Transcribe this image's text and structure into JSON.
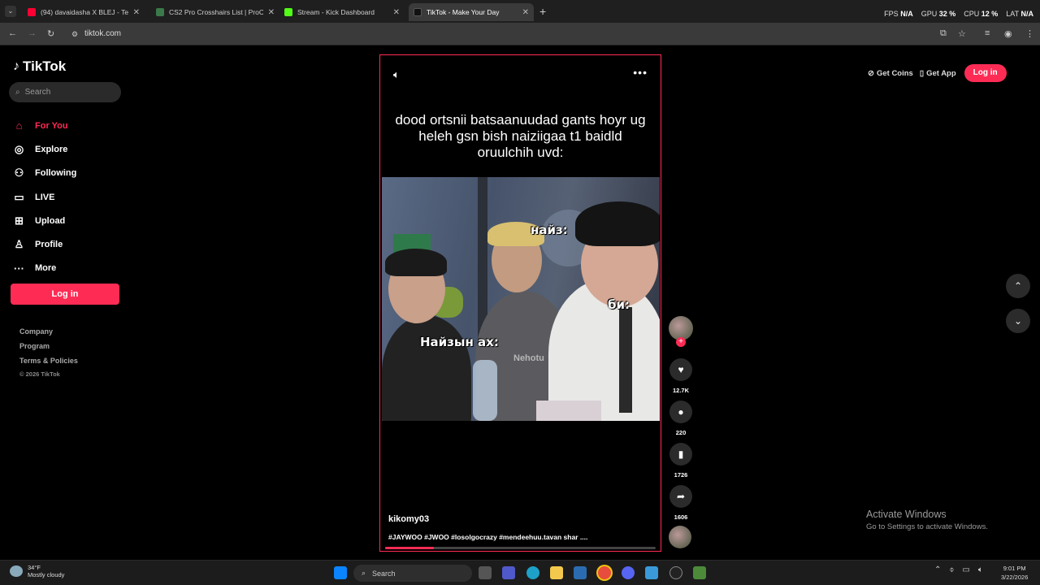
{
  "browser": {
    "tabs": [
      {
        "title": "(94) davaidasha X BLEJ - Temtm",
        "favicon_color": "#ff0033",
        "active": false
      },
      {
        "title": "CS2 Pro Crosshairs List | ProCro",
        "favicon_color": "#3a7a4a",
        "active": false
      },
      {
        "title": "Stream - Kick Dashboard",
        "favicon_color": "#53fc18",
        "active": false
      },
      {
        "title": "TikTok - Make Your Day",
        "favicon_color": "#111111",
        "active": true
      }
    ],
    "url": "tiktok.com",
    "perf": {
      "fps_label": "FPS",
      "fps": "N/A",
      "gpu_label": "GPU",
      "gpu": "32 %",
      "cpu_label": "CPU",
      "cpu": "12 %",
      "lat_label": "LAT",
      "lat": "N/A"
    }
  },
  "sidebar": {
    "logo": "TikTok",
    "search_placeholder": "Search",
    "items": [
      {
        "label": "For You",
        "icon": "home-icon",
        "active": true
      },
      {
        "label": "Explore",
        "icon": "compass-icon",
        "active": false
      },
      {
        "label": "Following",
        "icon": "following-icon",
        "active": false
      },
      {
        "label": "LIVE",
        "icon": "live-icon",
        "active": false
      },
      {
        "label": "Upload",
        "icon": "upload-icon",
        "active": false
      },
      {
        "label": "Profile",
        "icon": "profile-icon",
        "active": false
      },
      {
        "label": "More",
        "icon": "more-icon",
        "active": false
      }
    ],
    "login_label": "Log in",
    "footer_links": [
      "Company",
      "Program",
      "Terms & Policies"
    ],
    "copyright": "© 2026 TikTok"
  },
  "video": {
    "caption": "dood ortsnii batsaanuudad gants hoyr ug heleh gsn bish naiziigaa t1 baidld oruulchih uvd:",
    "overlay_labels": [
      "найз:",
      "би:",
      "Найзын ах:"
    ],
    "watermark": "Nehotu",
    "username": "kikomy03",
    "description": "#JAYWOO #JWOO #losolgocrazy #mendeehuu.tavan shar ....",
    "progress": 0.18
  },
  "actions": {
    "likes": "12.7K",
    "comments": "220",
    "saves": "1726",
    "shares": "1606"
  },
  "topbar": {
    "get_coins": "Get Coins",
    "get_app": "Get App",
    "login_label": "Log in"
  },
  "watermark_windows": {
    "line1": "Activate Windows",
    "line2": "Go to Settings to activate Windows."
  },
  "taskbar": {
    "temperature": "34°F",
    "weather": "Mostly cloudy",
    "search_label": "Search",
    "time": "9:01 PM",
    "date": "3/22/2026"
  },
  "colors": {
    "accent": "#fe2c55"
  }
}
